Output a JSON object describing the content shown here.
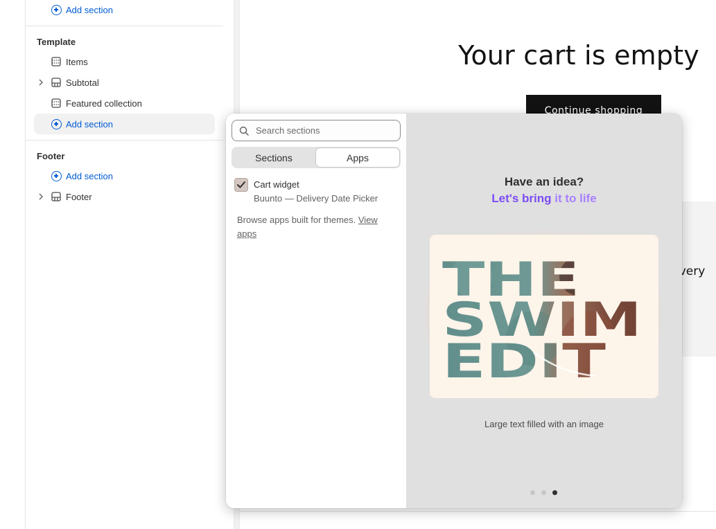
{
  "sidebar": {
    "top_add_section": "Add section",
    "template": {
      "title": "Template",
      "items": [
        {
          "label": "Items"
        },
        {
          "label": "Subtotal"
        },
        {
          "label": "Featured collection"
        }
      ],
      "add_section": "Add section"
    },
    "footer": {
      "title": "Footer",
      "add_section": "Add section",
      "items": [
        {
          "label": "Footer"
        }
      ]
    }
  },
  "preview": {
    "cart_title": "Your cart is empty",
    "continue_button": "Continue shopping",
    "partial_text": "ivery"
  },
  "popover": {
    "search": {
      "placeholder": "Search sections",
      "value": ""
    },
    "tabs": [
      {
        "label": "Sections",
        "active": false
      },
      {
        "label": "Apps",
        "active": true
      }
    ],
    "app_item": {
      "name": "Cart widget",
      "subtitle": "Buunto — Delivery Date Picker",
      "checked": true
    },
    "browse_text": "Browse apps built for themes.",
    "browse_link": "View apps",
    "promo": {
      "title": "Have an idea?",
      "subtitle_strong": "Let's bring ",
      "subtitle_soft": "it to life",
      "card_words": [
        "THE",
        "SWIM",
        "EDIT"
      ],
      "caption": "Large text filled with an image",
      "pager": {
        "count": 3,
        "active": 3
      }
    }
  },
  "colors": {
    "accent_link": "#005bd3",
    "promo_purple": "#7b4cf2",
    "dark_button": "#121212"
  }
}
